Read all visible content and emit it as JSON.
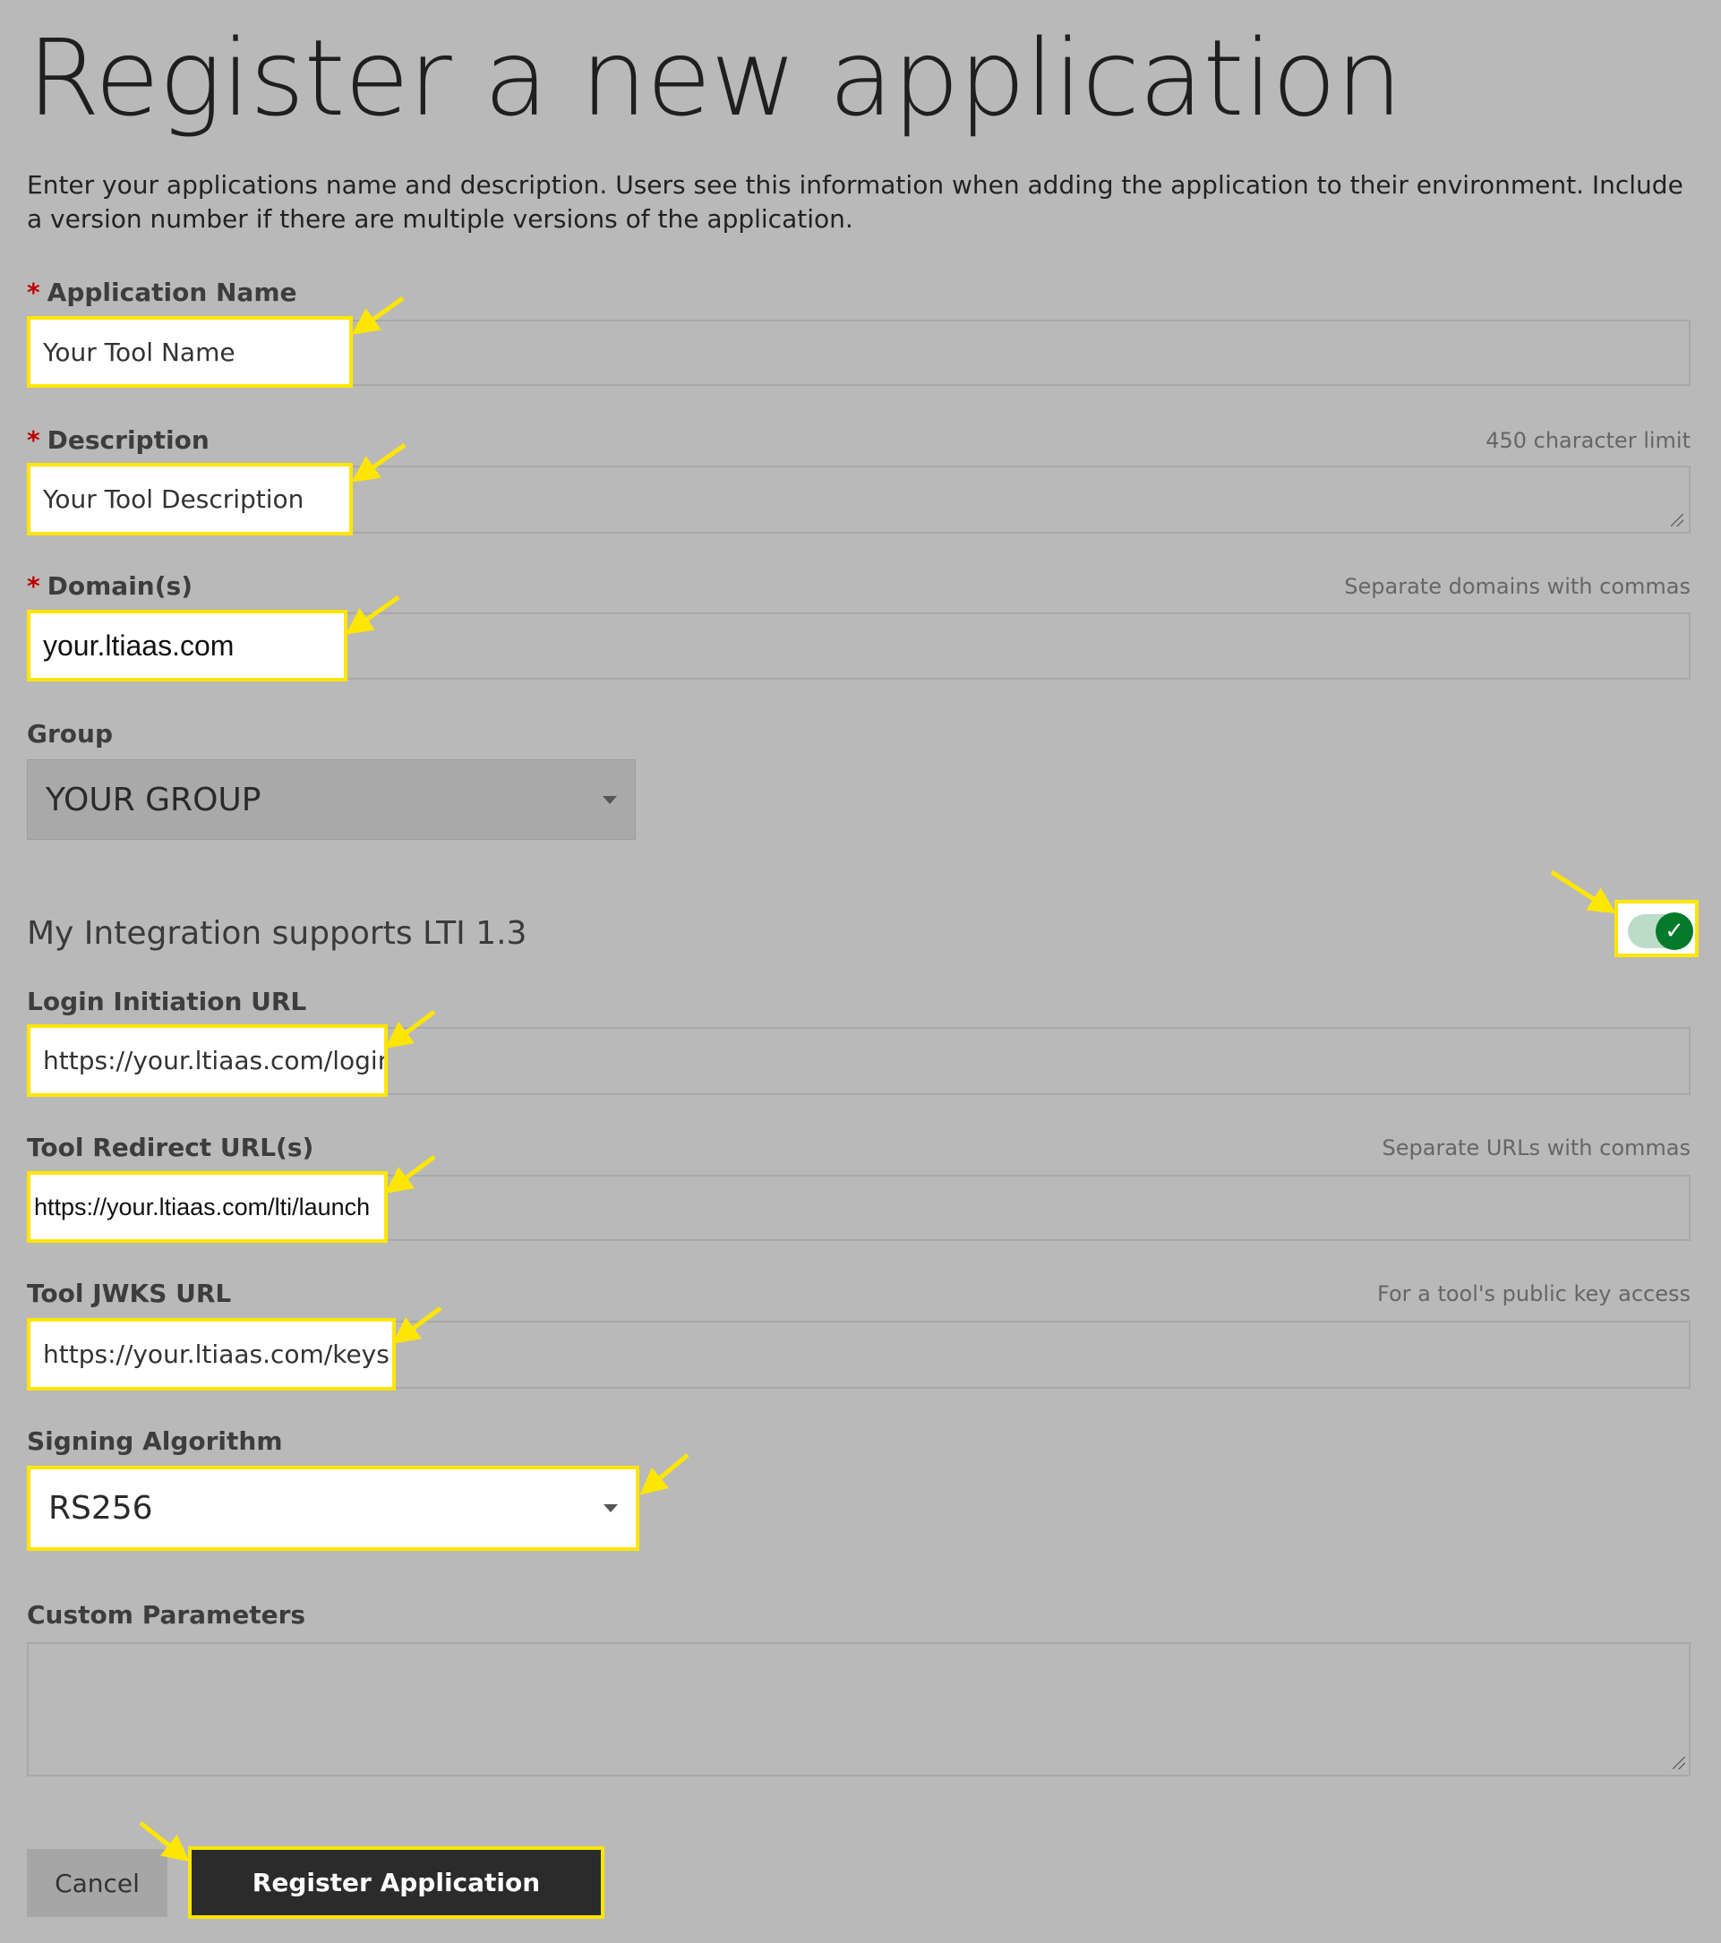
{
  "page_title": "Register a new application",
  "intro": "Enter your applications name and description. Users see this information when adding the application to their environment. Include a version number if there are multiple versions of the application.",
  "required_marker": "*",
  "fields": {
    "app_name": {
      "label": "Application Name",
      "value": "Your Tool Name"
    },
    "description": {
      "label": "Description",
      "hint": "450 character limit",
      "value": "Your Tool Description"
    },
    "domains": {
      "label": "Domain(s)",
      "hint": "Separate domains with commas",
      "value": "your.ltiaas.com"
    },
    "group": {
      "label": "Group",
      "value": "YOUR GROUP"
    },
    "lti13": {
      "label": "My Integration supports LTI 1.3",
      "enabled": true
    },
    "login_url": {
      "label": "Login Initiation URL",
      "value": "https://your.ltiaas.com/login"
    },
    "redirect_urls": {
      "label": "Tool Redirect URL(s)",
      "hint": "Separate URLs with commas",
      "value": "https://your.ltiaas.com/lti/launch"
    },
    "jwks_url": {
      "label": "Tool JWKS URL",
      "hint": "For a tool's public key access",
      "value": "https://your.ltiaas.com/keys"
    },
    "signing_algorithm": {
      "label": "Signing Algorithm",
      "value": "RS256"
    },
    "custom_params": {
      "label": "Custom Parameters",
      "value": ""
    }
  },
  "buttons": {
    "cancel": "Cancel",
    "register": "Register Application"
  },
  "colors": {
    "highlight": "#ffe600",
    "toggle_on": "#047a2b",
    "toggle_track": "#bcdcc8",
    "required": "#c00000",
    "primary_button": "#2b2b2b"
  }
}
